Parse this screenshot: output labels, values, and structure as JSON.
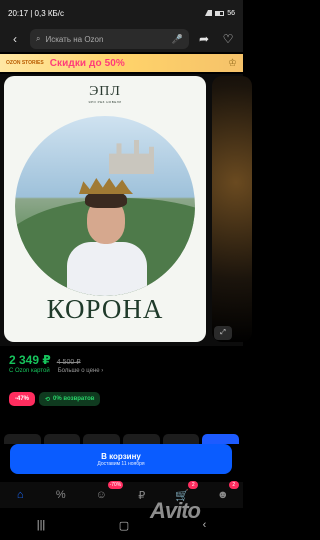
{
  "status": {
    "time_speed": "20:17 | 0,3 КБ/с",
    "battery": "56"
  },
  "search": {
    "placeholder": "Искать на Ozon"
  },
  "promo": {
    "brand": "OZON STORIES",
    "headline": "Скидки до 50%"
  },
  "product": {
    "logo": "ЭПЛ",
    "logo_tagline": "ЭРО РЕЗ НОВЕЛЛ",
    "title": "КОРОНА"
  },
  "pricing": {
    "price": "2 349 ₽",
    "old_price": "4 500 ₽",
    "card_label": "С Ozon картой",
    "more_label": "Больше о цене ›",
    "discount": "-47%",
    "returns": "0% возвратов"
  },
  "cart": {
    "label": "В корзину",
    "delivery": "Доставим 11 ноября"
  },
  "nav": {
    "promo_badge": "-70%",
    "cart_badge": "2",
    "profile_badge": "2"
  },
  "watermark": "Avito",
  "colors": {
    "accent": "#0a5cff",
    "price": "#16c45c",
    "discount": "#ff2d5f"
  }
}
